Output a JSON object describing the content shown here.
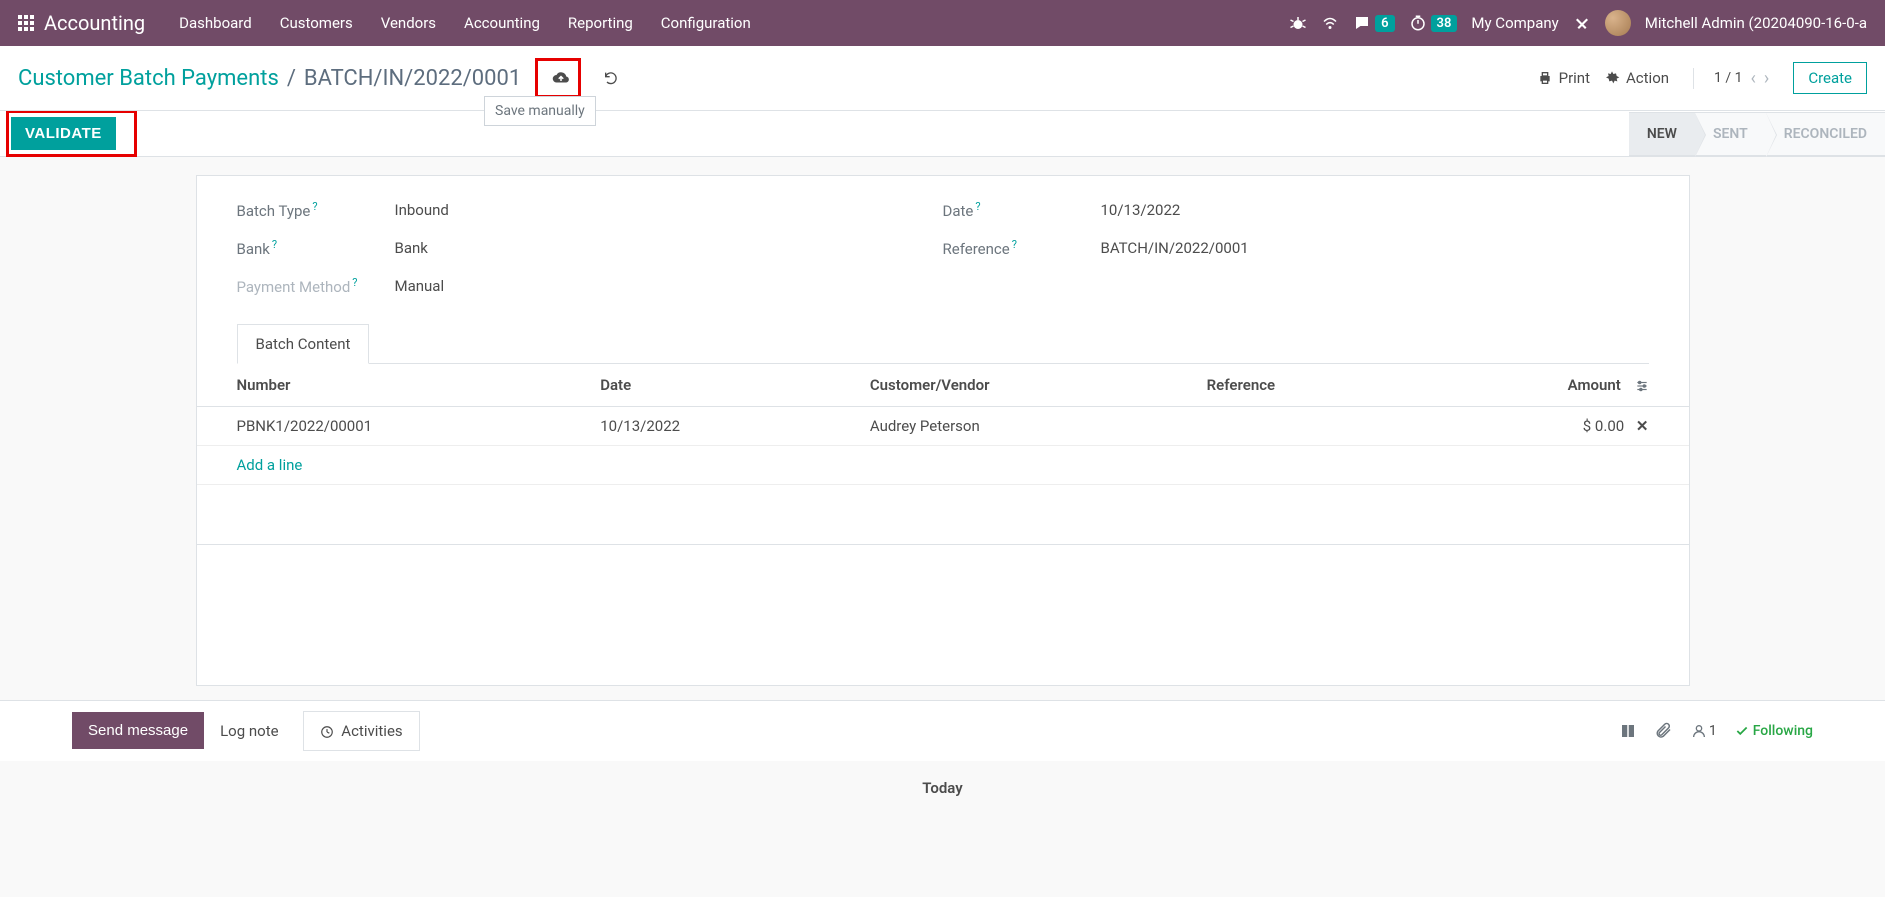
{
  "topnav": {
    "title": "Accounting",
    "menu": [
      "Dashboard",
      "Customers",
      "Vendors",
      "Accounting",
      "Reporting",
      "Configuration"
    ],
    "msg_badge": "6",
    "timer_badge": "38",
    "company": "My Company",
    "user": "Mitchell Admin (20204090-16-0-a"
  },
  "breadcrumb": {
    "parent": "Customer Batch Payments",
    "current": "BATCH/IN/2022/0001",
    "tooltip": "Save manually",
    "print": "Print",
    "action": "Action",
    "pager": "1 / 1",
    "create": "Create"
  },
  "actionbar": {
    "validate": "VALIDATE",
    "steps": [
      "NEW",
      "SENT",
      "RECONCILED"
    ]
  },
  "form": {
    "left": {
      "batch_type_lbl": "Batch Type",
      "batch_type": "Inbound",
      "bank_lbl": "Bank",
      "bank": "Bank",
      "pm_lbl": "Payment Method",
      "pm": "Manual"
    },
    "right": {
      "date_lbl": "Date",
      "date": "10/13/2022",
      "ref_lbl": "Reference",
      "ref": "BATCH/IN/2022/0001"
    },
    "tab": "Batch Content",
    "cols": {
      "number": "Number",
      "date": "Date",
      "cv": "Customer/Vendor",
      "ref": "Reference",
      "amount": "Amount"
    },
    "rows": [
      {
        "number": "PBNK1/2022/00001",
        "date": "10/13/2022",
        "cv": "Audrey Peterson",
        "ref": "",
        "amount": "$ 0.00"
      }
    ],
    "add_line": "Add a line"
  },
  "chatter": {
    "send": "Send message",
    "log": "Log note",
    "activities": "Activities",
    "follower_count": "1",
    "following": "Following",
    "today": "Today"
  }
}
